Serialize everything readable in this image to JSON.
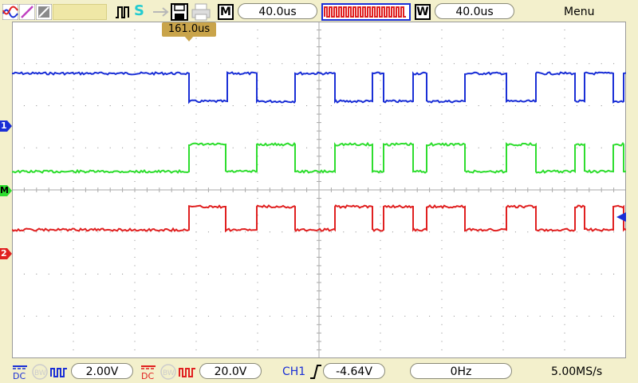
{
  "top": {
    "time_mode_badge": "M",
    "time_base": "40.0us",
    "window_badge": "W",
    "window_time": "40.0us",
    "menu_label": "Menu",
    "trigger_position": "161.0us"
  },
  "channel_markers": {
    "ch1": "1",
    "ch2": "2",
    "math": "M"
  },
  "bottom": {
    "ch1_volts": "2.00V",
    "ch2_volts": "20.0V",
    "trigger_source": "CH1",
    "trigger_level": "-4.64V",
    "frequency": "0Hz",
    "sample_rate": "5.00MS/s"
  },
  "colors": {
    "ch1": "#1a2fd6",
    "ch2": "#e02020",
    "math": "#2edd2e",
    "trigger": "#c9a44a",
    "grid_bg": "#ffffff"
  },
  "icons": [
    "waveform-icon",
    "cursor-icon",
    "gray-icon",
    "run-icon",
    "save-icon",
    "print-icon"
  ]
}
